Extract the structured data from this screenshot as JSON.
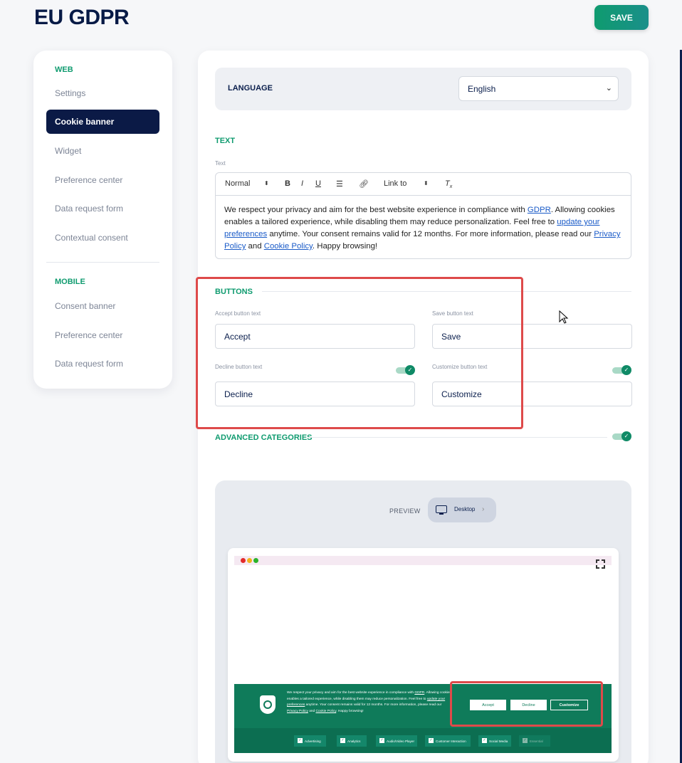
{
  "page_title": "EU GDPR",
  "save_label": "SAVE",
  "sidebar": {
    "web_section": "WEB",
    "web_items": [
      "Settings",
      "Cookie banner",
      "Widget",
      "Preference center",
      "Data request form",
      "Contextual consent"
    ],
    "mobile_section": "MOBILE",
    "mobile_items": [
      "Consent banner",
      "Preference center",
      "Data request form"
    ],
    "active_item": "Cookie banner"
  },
  "language": {
    "label": "LANGUAGE",
    "selected": "English"
  },
  "text_section": {
    "title": "TEXT",
    "field_label": "Text",
    "toolbar": {
      "format": "Normal",
      "bold": "B",
      "italic": "I",
      "underline": "U",
      "link_to": "Link to"
    },
    "content": {
      "p1": "We respect your privacy and aim for the best website experience in compliance with ",
      "link1": "GDPR",
      "p2": ". Allowing cookies enables a tailored experience, while disabling them may reduce personalization. Feel free to ",
      "link2": "update your preferences",
      "p3": " anytime. Your consent remains valid for 12 months. For more information, please read our ",
      "link3": "Privacy Policy",
      "p4": " and ",
      "link4": "Cookie Policy",
      "p5": ". Happy browsing!"
    }
  },
  "buttons_section": {
    "title": "BUTTONS",
    "accept_label": "Accept button text",
    "accept_value": "Accept",
    "save_label": "Save button text",
    "save_value": "Save",
    "decline_label": "Decline button text",
    "decline_value": "Decline",
    "decline_enabled": true,
    "customize_label": "Customize button text",
    "customize_value": "Customize",
    "customize_enabled": true
  },
  "advanced_section": {
    "title": "ADVANCED CATEGORIES",
    "enabled": true
  },
  "preview": {
    "label": "PREVIEW",
    "device": "Desktop",
    "banner_buttons": [
      "Accept",
      "Decline",
      "Customize"
    ],
    "categories": [
      "Advertising",
      "Analytics",
      "Audio/Video Player",
      "Customer Interaction",
      "Social Media",
      "Essential"
    ]
  },
  "colors": {
    "brand_green": "#0f9b6f",
    "navy": "#0b1a46",
    "highlight_red": "#de4a4a",
    "banner_green": "#0f7b5a"
  }
}
